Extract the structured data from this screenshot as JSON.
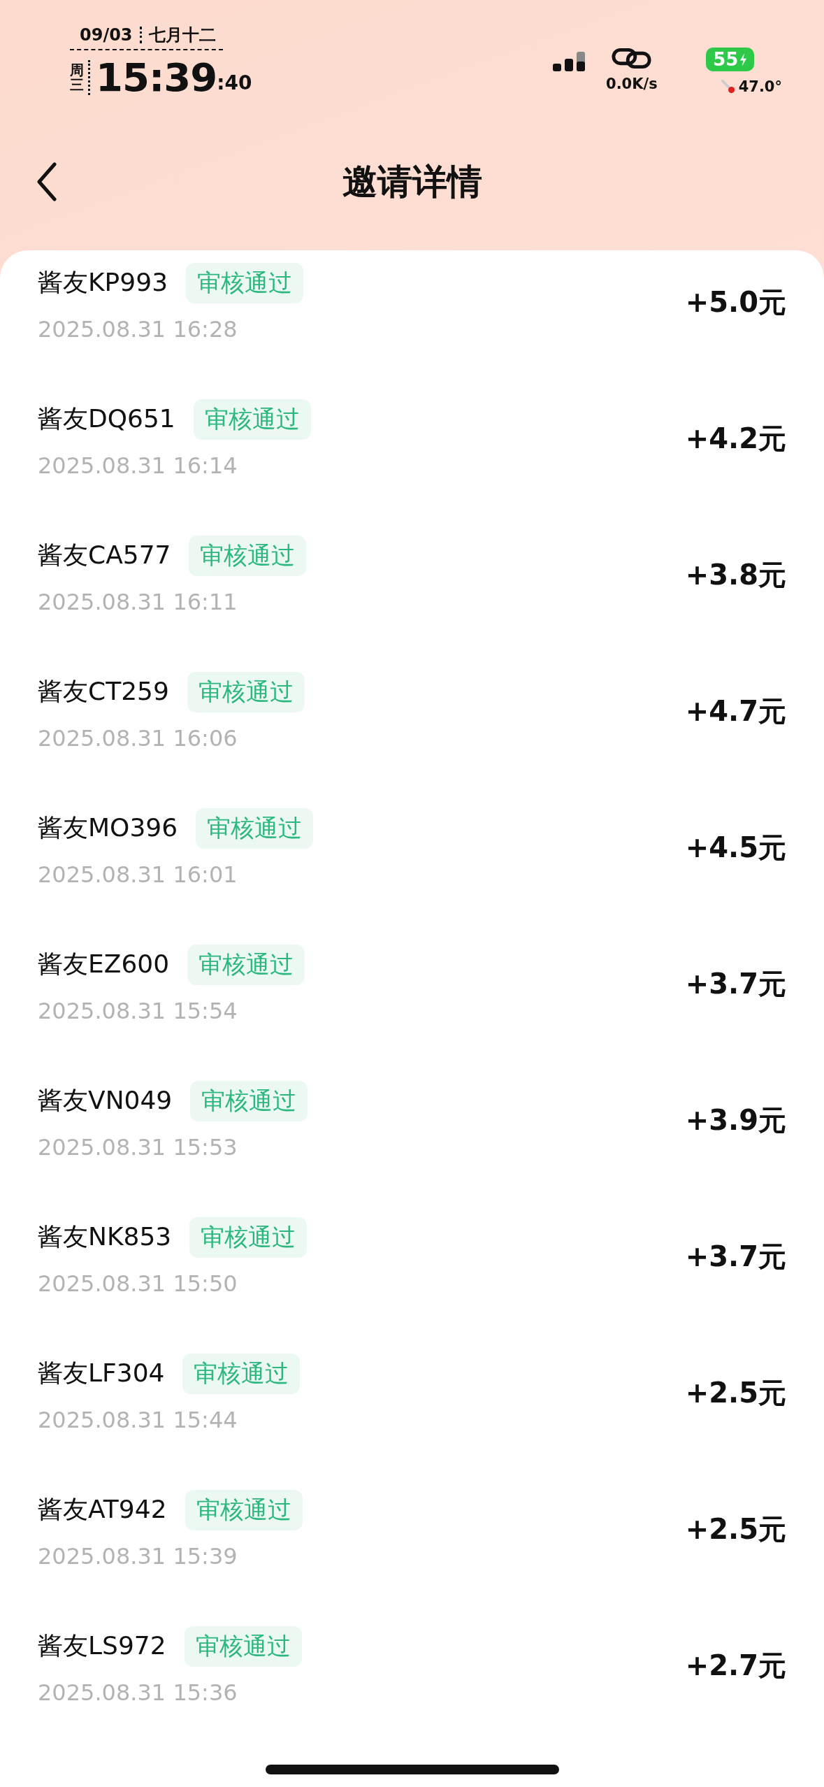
{
  "status_bar": {
    "date": "09/03",
    "lunar_date": "七月十二",
    "weekday": "周三",
    "time": "15:39",
    "seconds": ":40",
    "net_speed": "0.0K/s",
    "battery": "55",
    "temperature": "47.0°"
  },
  "header": {
    "title": "邀请详情"
  },
  "invites": [
    {
      "name": "酱友KP993",
      "status": "审核通过",
      "time": "2025.08.31 16:28",
      "amount": "+5.0元"
    },
    {
      "name": "酱友DQ651",
      "status": "审核通过",
      "time": "2025.08.31 16:14",
      "amount": "+4.2元"
    },
    {
      "name": "酱友CA577",
      "status": "审核通过",
      "time": "2025.08.31 16:11",
      "amount": "+3.8元"
    },
    {
      "name": "酱友CT259",
      "status": "审核通过",
      "time": "2025.08.31 16:06",
      "amount": "+4.7元"
    },
    {
      "name": "酱友MO396",
      "status": "审核通过",
      "time": "2025.08.31 16:01",
      "amount": "+4.5元"
    },
    {
      "name": "酱友EZ600",
      "status": "审核通过",
      "time": "2025.08.31 15:54",
      "amount": "+3.7元"
    },
    {
      "name": "酱友VN049",
      "status": "审核通过",
      "time": "2025.08.31 15:53",
      "amount": "+3.9元"
    },
    {
      "name": "酱友NK853",
      "status": "审核通过",
      "time": "2025.08.31 15:50",
      "amount": "+3.7元"
    },
    {
      "name": "酱友LF304",
      "status": "审核通过",
      "time": "2025.08.31 15:44",
      "amount": "+2.5元"
    },
    {
      "name": "酱友AT942",
      "status": "审核通过",
      "time": "2025.08.31 15:39",
      "amount": "+2.5元"
    },
    {
      "name": "酱友LS972",
      "status": "审核通过",
      "time": "2025.08.31 15:36",
      "amount": "+2.7元"
    }
  ]
}
